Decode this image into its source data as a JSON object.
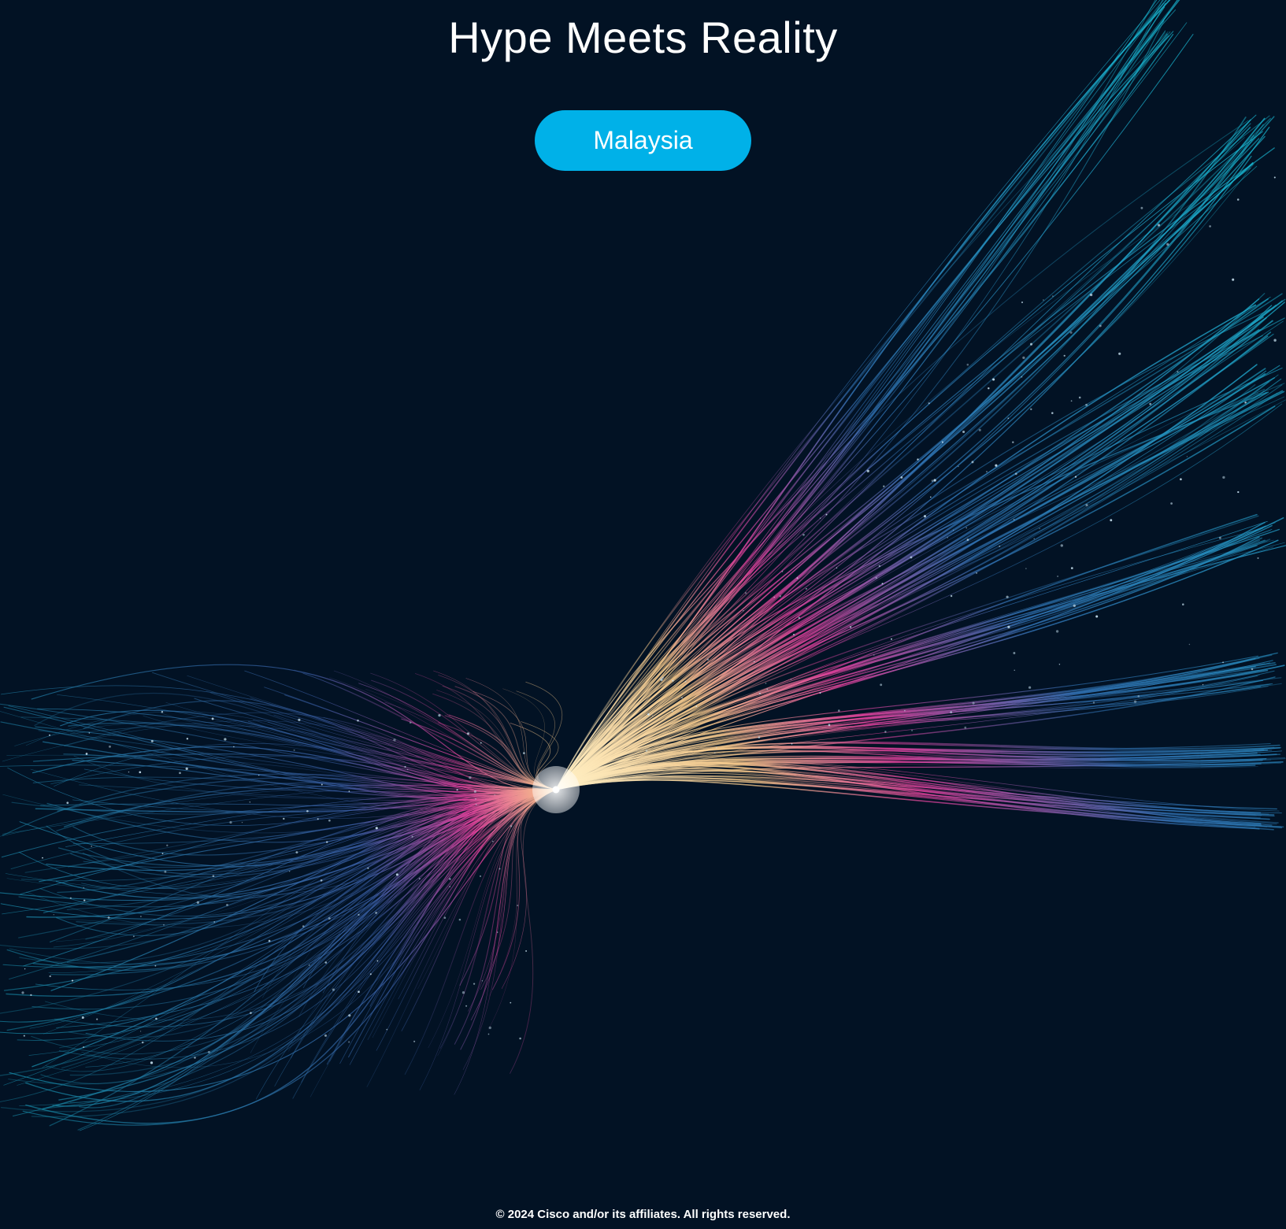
{
  "header": {
    "title": "Hype Meets Reality"
  },
  "region_button": {
    "label": "Malaysia"
  },
  "footer": {
    "copyright": "© 2024 Cisco and/or its affiliates. All rights reserved."
  },
  "colors": {
    "background": "#021224",
    "accent": "#00b1e8",
    "strand_cyan": "#18a8c8",
    "strand_blue": "#2f6fb0",
    "strand_magenta": "#e0409c",
    "strand_gold": "#f7c98a",
    "text": "#ffffff"
  },
  "artwork": {
    "name": "light-strands-illustration"
  }
}
